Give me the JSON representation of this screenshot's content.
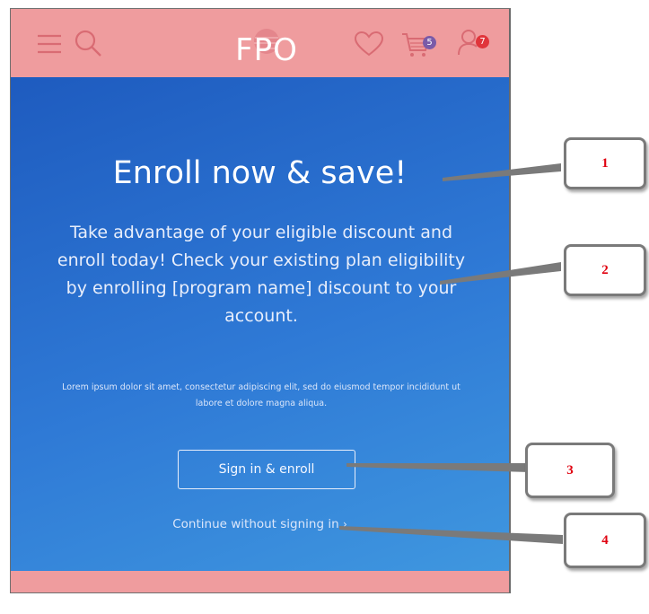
{
  "header": {
    "logo_text": "FPO",
    "cart_badge": "5",
    "account_badge": "7",
    "icons": [
      "menu-icon",
      "search-icon",
      "heart-icon",
      "cart-icon",
      "account-icon"
    ]
  },
  "hero": {
    "title": "Enroll now & save!",
    "subtitle": "Take advantage of your eligible discount and enroll today!  Check your existing plan eligibility by enrolling [program name] discount to your account.",
    "fineprint": "Lorem ipsum dolor sit amet, consectetur adipiscing elit, sed do eiusmod tempor incididunt ut labore et dolore magna aliqua.",
    "primary_button": "Sign in & enroll",
    "secondary_link": "Continue without signing in"
  },
  "annotations": {
    "callout_1": "1",
    "callout_2": "2",
    "callout_3": "3",
    "callout_4": "4"
  },
  "colors": {
    "header_bg": "#ef9c9e",
    "hero_gradient_start": "#1e5bbf",
    "hero_gradient_end": "#3f97df",
    "badge_purple": "#7a5ba8",
    "badge_red": "#e0353b",
    "callout_text": "#e0000f"
  }
}
